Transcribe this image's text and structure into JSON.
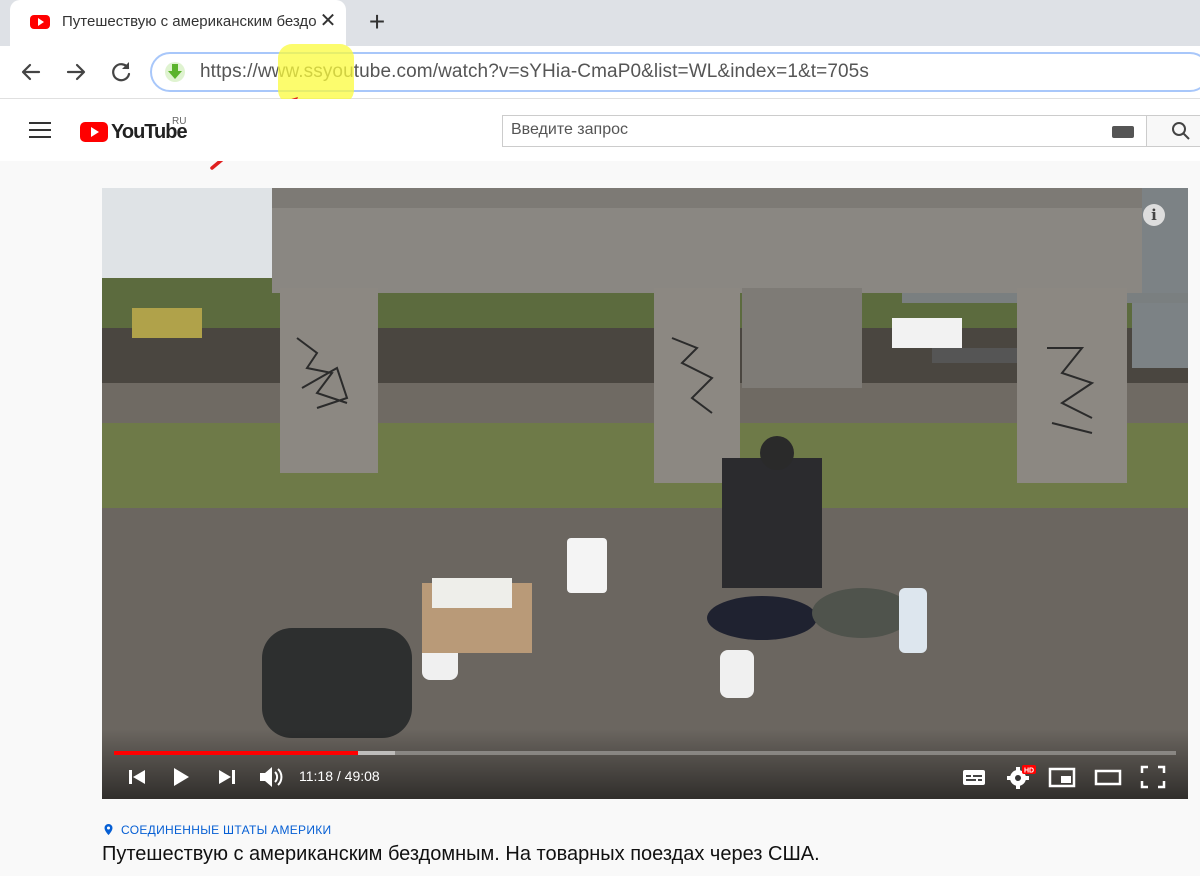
{
  "browser": {
    "tab_title": "Путешествую с американским бездомным. На товарных поездах через США",
    "tab_close": "✕",
    "new_tab": "+",
    "url": "https://www.ssyoutube.com/watch?v=sYHia-CmaP0&list=WL&index=1&t=705s"
  },
  "youtube": {
    "logo_text": "YouTube",
    "region": "RU",
    "search_placeholder": "Введите запрос"
  },
  "player": {
    "current_time": "11:18",
    "duration": "49:08",
    "time_display": "11:18 / 49:08",
    "progress_fraction": 0.23,
    "buffered_fraction": 0.265,
    "hd_badge": "HD",
    "info": "i"
  },
  "video": {
    "location": "СОЕДИНЕННЫЕ ШТАТЫ АМЕРИКИ",
    "title": "Путешествую с американским бездомным. На товарных поездах через США."
  },
  "colors": {
    "youtube_red": "#ff0000",
    "link_blue": "#065fd4",
    "annotation_red": "#e02020",
    "highlight_yellow": "#fbfb3c"
  }
}
